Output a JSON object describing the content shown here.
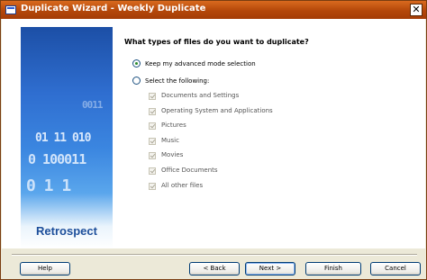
{
  "window": {
    "title": "Duplicate Wizard - Weekly Duplicate",
    "close_glyph": "✕"
  },
  "banner": {
    "brand": "Retrospect",
    "numbers": [
      "0011",
      "01 11 010",
      "0 100011",
      "0 1 1"
    ]
  },
  "question": "What types of files do you want to duplicate?",
  "options": {
    "keep": {
      "label": "Keep my advanced mode selection",
      "selected": true
    },
    "select": {
      "label": "Select the following:",
      "selected": false
    }
  },
  "file_types": [
    {
      "label": "Documents and Settings",
      "checked": true,
      "enabled": false
    },
    {
      "label": "Operating System and Applications",
      "checked": true,
      "enabled": false
    },
    {
      "label": "Pictures",
      "checked": true,
      "enabled": false
    },
    {
      "label": "Music",
      "checked": true,
      "enabled": false
    },
    {
      "label": "Movies",
      "checked": true,
      "enabled": false
    },
    {
      "label": "Office Documents",
      "checked": true,
      "enabled": false
    },
    {
      "label": "All other files",
      "checked": true,
      "enabled": false
    }
  ],
  "buttons": {
    "help": "Help",
    "back": "< Back",
    "next": "Next >",
    "finish": "Finish",
    "cancel": "Cancel"
  },
  "icons": {
    "app": "window-icon",
    "close": "close-icon"
  }
}
